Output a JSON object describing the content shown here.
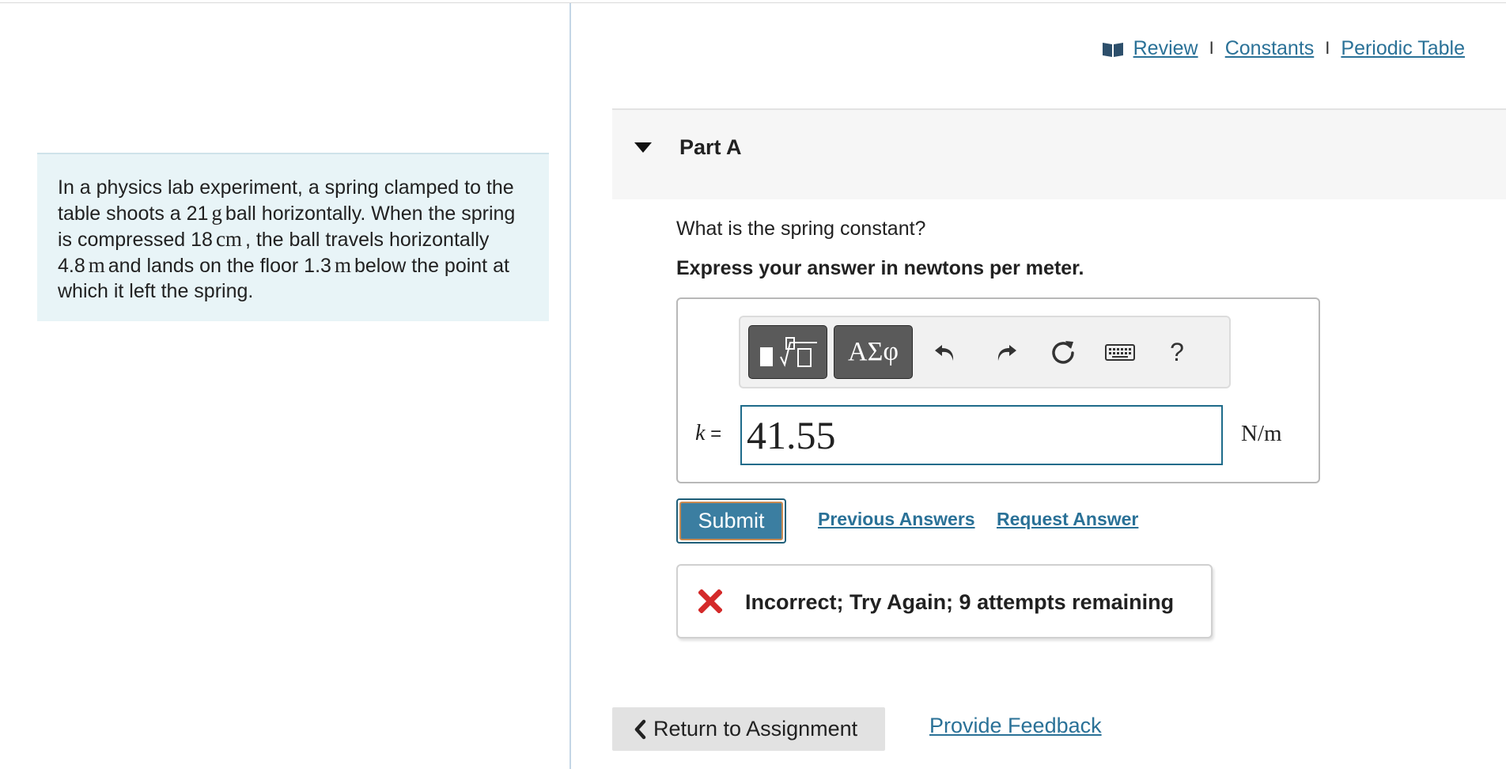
{
  "problem": {
    "text_1": "In a physics lab experiment, a spring clamped to the table shoots a 21",
    "unit_mass": "g",
    "text_2": "ball horizontally. When the spring is compressed 18",
    "unit_compression": "cm",
    "text_3": ", the ball travels horizontally 4.8",
    "unit_distance": "m",
    "text_4": "and lands on the floor 1.3",
    "unit_height": "m",
    "text_5": "below the point at which it left the spring."
  },
  "resources": {
    "review": "Review",
    "separator": "I",
    "constants": "Constants",
    "periodic_table": "Periodic Table"
  },
  "part": {
    "title": "Part A",
    "question": "What is the spring constant?",
    "instruction": "Express your answer in newtons per meter."
  },
  "toolbar": {
    "symbols_label": "ΑΣφ",
    "help_label": "?"
  },
  "answer": {
    "variable": "k",
    "equals": "=",
    "value": "41.55",
    "unit": "N/m"
  },
  "actions": {
    "submit": "Submit",
    "previous_answers": "Previous Answers",
    "request_answer": "Request Answer"
  },
  "feedback": {
    "message": "Incorrect; Try Again; 9 attempts remaining"
  },
  "footer": {
    "return_label": "Return to Assignment",
    "provide_feedback": "Provide Feedback"
  },
  "colors": {
    "link": "#2a7197",
    "submit_bg": "#3b7ea1",
    "error_red": "#d42a2a",
    "problem_bg": "#e8f4f7"
  }
}
